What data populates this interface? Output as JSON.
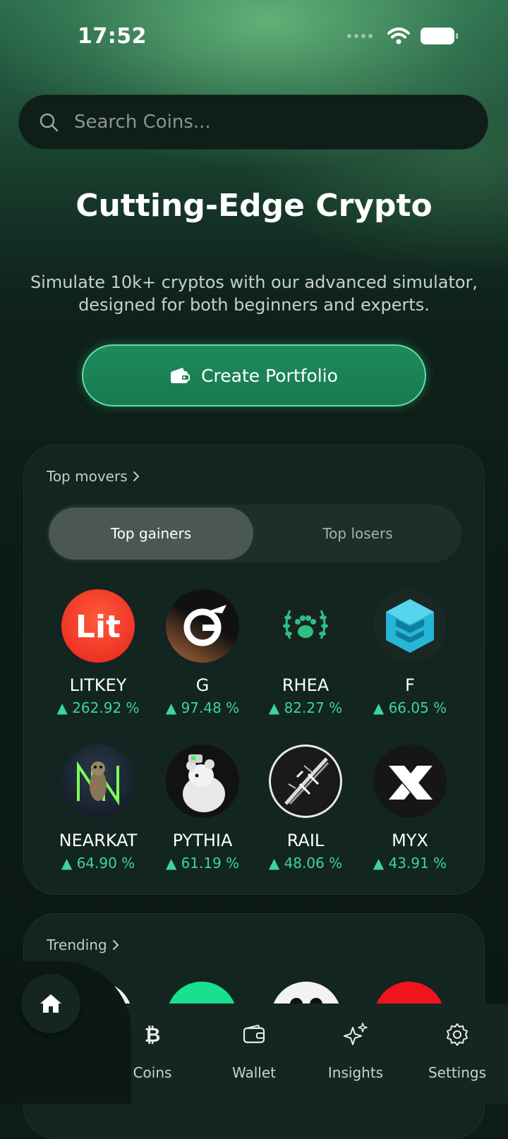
{
  "status": {
    "time": "17:52"
  },
  "search": {
    "placeholder": "Search Coins..."
  },
  "hero": {
    "title": "Cutting-Edge Crypto",
    "subtitle": "Simulate 10k+ cryptos with our advanced simulator, designed for both beginners and experts.",
    "cta": "Create Portfolio"
  },
  "movers": {
    "title": "Top movers",
    "tabs": [
      "Top gainers",
      "Top losers"
    ],
    "active_tab": "Top gainers",
    "coins": [
      {
        "symbol": "LITKEY",
        "change": "262.92 %",
        "icon": "litkey-logo"
      },
      {
        "symbol": "G",
        "change": "97.48 %",
        "icon": "g-logo"
      },
      {
        "symbol": "RHEA",
        "change": "82.27 %",
        "icon": "rhea-laurel-paw-logo"
      },
      {
        "symbol": "F",
        "change": "66.05 %",
        "icon": "f-cube-logo"
      },
      {
        "symbol": "NEARKAT",
        "change": "64.90 %",
        "icon": "nearkat-meerkat-logo"
      },
      {
        "symbol": "PYTHIA",
        "change": "61.19 %",
        "icon": "pythia-rat-logo"
      },
      {
        "symbol": "RAIL",
        "change": "48.06 %",
        "icon": "rail-barbed-wire-logo"
      },
      {
        "symbol": "MYX",
        "change": "43.91 %",
        "icon": "myx-x-logo"
      }
    ],
    "up_color": "#3ed49b"
  },
  "trending": {
    "title": "Trending"
  },
  "nav": {
    "items": [
      {
        "label": "Coins",
        "icon": "bitcoin-icon"
      },
      {
        "label": "Wallet",
        "icon": "wallet-icon"
      },
      {
        "label": "Insights",
        "icon": "sparkles-icon"
      },
      {
        "label": "Settings",
        "icon": "gear-icon"
      }
    ],
    "home_icon": "home-icon"
  },
  "colors": {
    "accent": "#1f8a5c",
    "accent_border": "#5fe0a8",
    "background": "#0d1c16"
  }
}
